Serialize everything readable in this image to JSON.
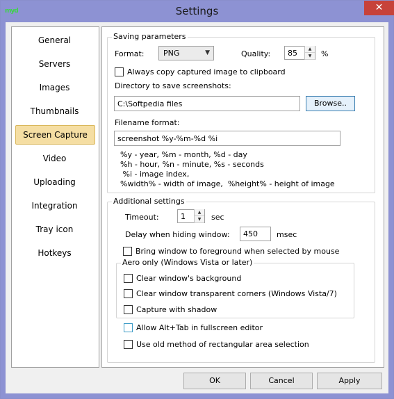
{
  "window": {
    "title": "Settings",
    "close_glyph": "✕",
    "icon_text": "myd"
  },
  "sidebar": {
    "items": [
      {
        "label": "General"
      },
      {
        "label": "Servers"
      },
      {
        "label": "Images"
      },
      {
        "label": "Thumbnails"
      },
      {
        "label": "Screen Capture",
        "selected": true
      },
      {
        "label": "Video"
      },
      {
        "label": "Uploading"
      },
      {
        "label": "Integration"
      },
      {
        "label": "Tray icon"
      },
      {
        "label": "Hotkeys"
      }
    ]
  },
  "saving": {
    "title": "Saving parameters",
    "format_label": "Format:",
    "format_value": "PNG",
    "quality_label": "Quality:",
    "quality_value": "85",
    "quality_unit": "%",
    "clipboard_label": "Always copy captured image to clipboard",
    "dir_label": "Directory to save screenshots:",
    "dir_value": "C:\\Softpedia files",
    "browse_label": "Browse..",
    "filename_label": "Filename format:",
    "filename_value": "screenshot %y-%m-%d %i",
    "help_lines": [
      "%y - year, %m - month, %d - day",
      "%h - hour, %n - minute, %s - seconds",
      " %i - image index,",
      "%width% - width of image,  %height% - height of image"
    ]
  },
  "additional": {
    "title": "Additional settings",
    "timeout_label": "Timeout:",
    "timeout_value": "1",
    "timeout_unit": "sec",
    "delay_label": "Delay when hiding window:",
    "delay_value": "450",
    "delay_unit": "msec",
    "bring_label": "Bring window to foreground when selected by mouse",
    "aero_title": "Aero only (Windows Vista or later)",
    "aero_items": [
      "Clear window's background",
      "Clear window transparent corners (Windows Vista/7)",
      "Capture with shadow"
    ]
  },
  "alttab_label": "Allow Alt+Tab in fullscreen editor",
  "oldmethod_label": "Use old method of rectangular area selection",
  "footer": {
    "ok": "OK",
    "cancel": "Cancel",
    "apply": "Apply"
  }
}
